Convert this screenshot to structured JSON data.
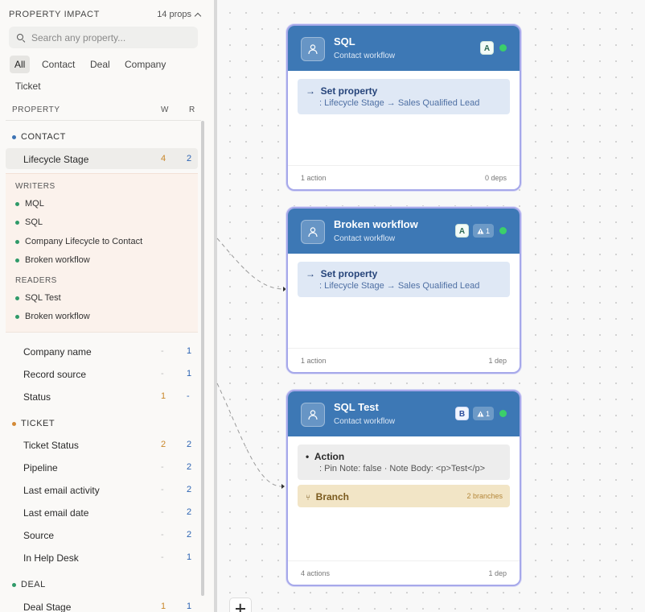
{
  "sidebar": {
    "title": "PROPERTY IMPACT",
    "count": "14 props",
    "search_placeholder": "Search any property...",
    "tabs": [
      "All",
      "Contact",
      "Deal",
      "Company",
      "Ticket"
    ],
    "active_tab": "All",
    "col_property": "PROPERTY",
    "col_w": "W",
    "col_r": "R",
    "groups": {
      "contact": {
        "label": "CONTACT",
        "color": "#3d73b4"
      },
      "ticket": {
        "label": "TICKET",
        "color": "#d38a36"
      },
      "deal": {
        "label": "DEAL",
        "color": "#2f9a69"
      }
    },
    "selected": {
      "name": "Lifecycle Stage",
      "w": "4",
      "r": "2"
    },
    "writers_label": "WRITERS",
    "writers": [
      "MQL",
      "SQL",
      "Company Lifecycle to Contact",
      "Broken workflow"
    ],
    "readers_label": "READERS",
    "readers": [
      "SQL Test",
      "Broken workflow"
    ],
    "contact_rows": [
      {
        "name": "Company name",
        "w": "-",
        "r": "1"
      },
      {
        "name": "Record source",
        "w": "-",
        "r": "1"
      },
      {
        "name": "Status",
        "w": "1",
        "r": "-"
      }
    ],
    "ticket_rows": [
      {
        "name": "Ticket Status",
        "w": "2",
        "r": "2"
      },
      {
        "name": "Pipeline",
        "w": "-",
        "r": "2"
      },
      {
        "name": "Last email activity",
        "w": "-",
        "r": "2"
      },
      {
        "name": "Last email date",
        "w": "-",
        "r": "2"
      },
      {
        "name": "Source",
        "w": "-",
        "r": "2"
      },
      {
        "name": "In Help Desk",
        "w": "-",
        "r": "1"
      }
    ],
    "deal_rows": [
      {
        "name": "Deal Stage",
        "w": "1",
        "r": "1"
      }
    ]
  },
  "nodes": [
    {
      "title": "SQL",
      "subtitle": "Contact workflow",
      "badge": "A",
      "warn": "",
      "action_label": "Set property",
      "action_detail": ": Lifecycle Stage → Sales Qualified Lead",
      "foot_left": "1 action",
      "foot_right": "0 deps"
    },
    {
      "title": "Broken workflow",
      "subtitle": "Contact workflow",
      "badge": "A",
      "warn": "1",
      "action_label": "Set property",
      "action_detail": ": Lifecycle Stage → Sales Qualified Lead",
      "foot_left": "1 action",
      "foot_right": "1 dep"
    },
    {
      "title": "SQL Test",
      "subtitle": "Contact workflow",
      "badge": "B",
      "warn": "1",
      "action_label": "Action",
      "action_detail": ": Pin Note: false · Note Body: <p>Test</p>",
      "branch_label": "Branch",
      "branch_count": "2 branches",
      "foot_left": "4 actions",
      "foot_right": "1 dep"
    }
  ],
  "colors": {
    "node_header": "#3d78b5",
    "node_border": "#a6a8ea",
    "status_active": "#3bcf6a",
    "writer_count": "#c9872a",
    "reader_count": "#2c64b3"
  }
}
